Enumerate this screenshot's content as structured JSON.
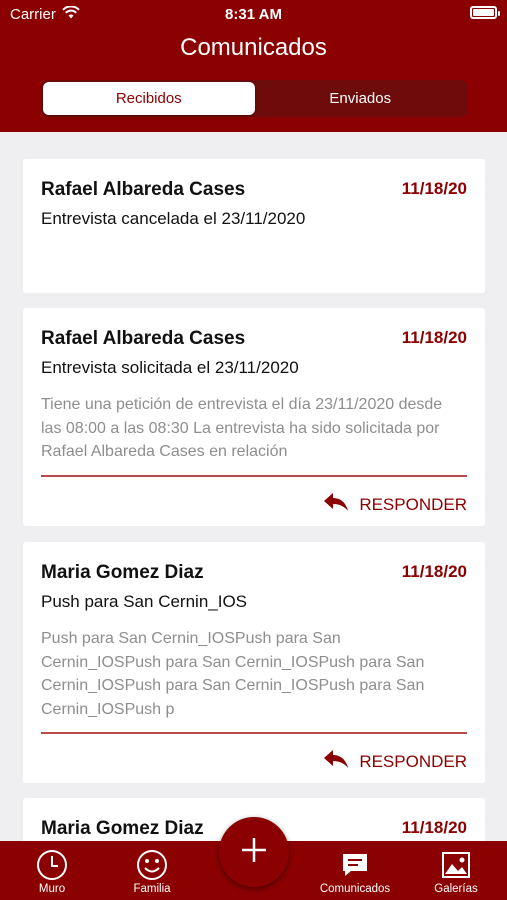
{
  "status_bar": {
    "carrier": "Carrier",
    "time": "8:31 AM"
  },
  "header": {
    "title": "Comunicados",
    "segments": [
      {
        "label": "Recibidos",
        "active": true
      },
      {
        "label": "Enviados",
        "active": false
      }
    ]
  },
  "messages": [
    {
      "sender": "Rafael Albareda Cases",
      "date": "11/18/20",
      "subject": "Entrevista cancelada el 23/11/2020",
      "preview": "",
      "reply_label": ""
    },
    {
      "sender": "Rafael Albareda Cases",
      "date": "11/18/20",
      "subject": "Entrevista solicitada el 23/11/2020",
      "preview": "Tiene una petición de entrevista el día 23/11/2020 desde las 08:00 a las 08:30 La entrevista ha sido solicitada por Rafael Albareda Cases en relación",
      "reply_label": "RESPONDER"
    },
    {
      "sender": "Maria Gomez Diaz",
      "date": "11/18/20",
      "subject": "Push para San Cernin_IOS",
      "preview": "Push para San Cernin_IOSPush para San Cernin_IOSPush para San Cernin_IOSPush para San Cernin_IOSPush para San Cernin_IOSPush para San Cernin_IOSPush p",
      "reply_label": "RESPONDER"
    },
    {
      "sender": "Maria Gomez Diaz",
      "date": "11/18/20"
    }
  ],
  "tabbar": {
    "items": [
      {
        "label": "Muro",
        "icon": "clock-icon"
      },
      {
        "label": "Familia",
        "icon": "smiley-icon"
      },
      {
        "label": "Comunicados",
        "icon": "message-icon"
      },
      {
        "label": "Galerías",
        "icon": "image-icon"
      }
    ],
    "fab_icon": "plus-icon"
  },
  "colors": {
    "primary": "#8b0000",
    "background": "#efeff1",
    "muted_text": "#8e8e8e"
  }
}
